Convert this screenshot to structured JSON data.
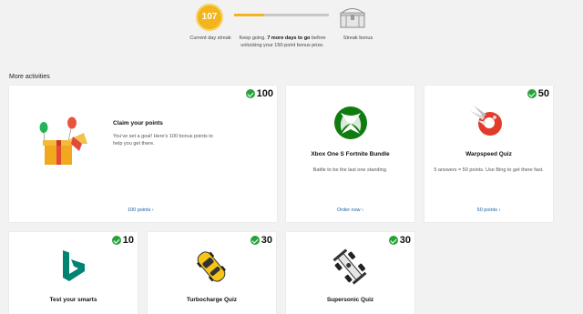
{
  "streak": {
    "current_days": "107",
    "current_label": "Current day streak",
    "progress_fraction": 0.32,
    "keep_going_prefix": "Keep going. ",
    "keep_going_bold": "7 more days to go",
    "keep_going_suffix": " before unlocking your 150-point bonus prize.",
    "bonus_label": "Streak bonus"
  },
  "section_title": "More activities",
  "cards": [
    {
      "points": "100",
      "title": "Claim your points",
      "desc": "You've set a goal! Here's 100 bonus points to help you get there.",
      "link": "100 points",
      "icon": "gift-box-icon"
    },
    {
      "points": "",
      "title": "Xbox One S Fortnite Bundle",
      "desc": "Battle to be the last one standing.",
      "link": "Order now",
      "icon": "xbox-logo-icon"
    },
    {
      "points": "50",
      "title": "Warpspeed Quiz",
      "desc": "5 answers = 50 points. Use Bing to get there fast.",
      "link": "50 points",
      "icon": "rocket-icon"
    },
    {
      "points": "10",
      "title": "Test your smarts",
      "icon": "bing-logo-icon"
    },
    {
      "points": "30",
      "title": "Turbocharge Quiz",
      "icon": "yellow-car-icon"
    },
    {
      "points": "30",
      "title": "Supersonic Quiz",
      "icon": "race-car-icon"
    }
  ],
  "colors": {
    "accent": "#f3b51b",
    "check": "#27a23a",
    "link": "#1a5fa3",
    "xbox": "#107c10",
    "bing": "#008373"
  }
}
